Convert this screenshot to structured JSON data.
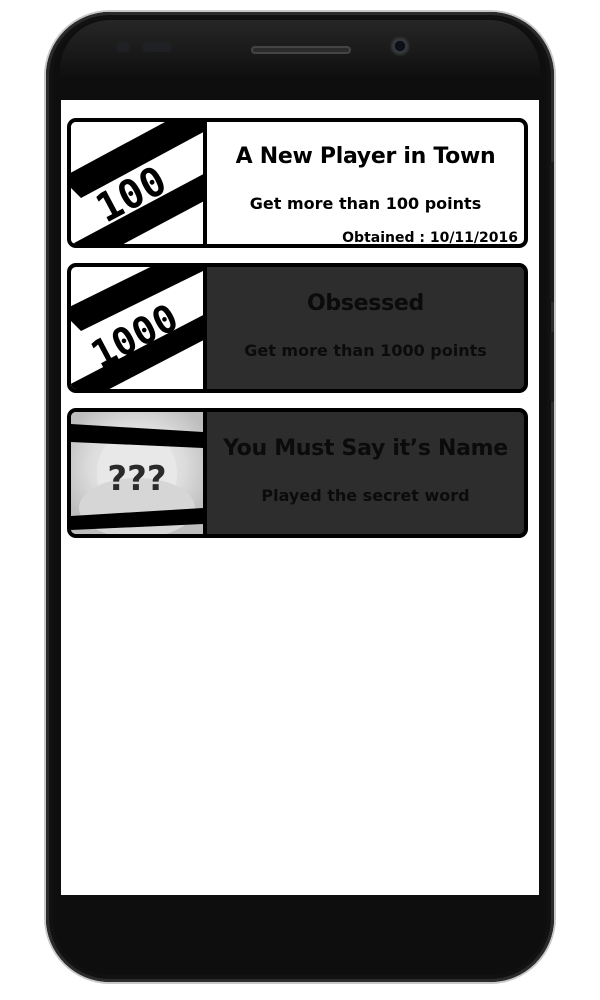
{
  "achievements": [
    {
      "badge_text": "100",
      "title": "A New Player in Town",
      "description": "Get more than 100 points",
      "obtained": "Obtained : 10/11/2016",
      "state": "unlocked"
    },
    {
      "badge_text": "1000",
      "title": "Obsessed",
      "description": "Get more than 1000 points",
      "state": "locked"
    },
    {
      "badge_text": "???",
      "title": "You Must Say it’s Name",
      "description": "Played the secret word",
      "state": "locked"
    }
  ],
  "colors": {
    "locked_card": "#2d2d2d",
    "unlocked_card": "#ffffff",
    "border": "#000000"
  }
}
